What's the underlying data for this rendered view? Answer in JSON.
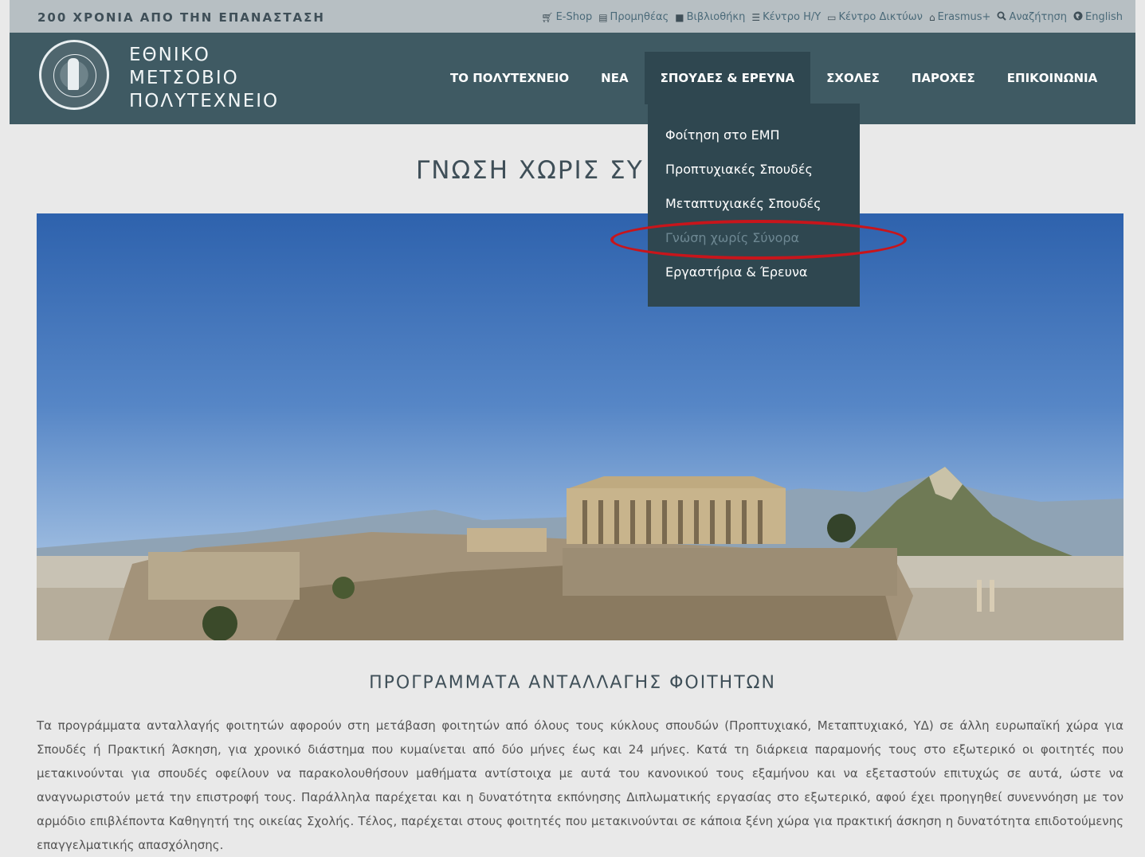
{
  "topbar": {
    "slogan": "200 ΧΡΟΝΙΑ ΑΠΟ ΤΗΝ ΕΠΑΝΑΣΤΑΣΗ",
    "links": [
      {
        "icon": "cart-icon",
        "label": "E-Shop"
      },
      {
        "icon": "newspaper-icon",
        "label": "Προμηθέας"
      },
      {
        "icon": "book-icon",
        "label": "Βιβλιοθήκη"
      },
      {
        "icon": "server-icon",
        "label": "Κέντρο Η/Υ"
      },
      {
        "icon": "network-icon",
        "label": "Κέντρο Δικτύων"
      },
      {
        "icon": "institution-icon",
        "label": "Erasmus+"
      },
      {
        "icon": "search-icon",
        "label": "Αναζήτηση"
      },
      {
        "icon": "globe-icon",
        "label": "English"
      }
    ]
  },
  "logo": {
    "lines": [
      "ΕΘΝΙΚΟ",
      "ΜΕΤΣΟΒΙΟ",
      "ΠΟΛΥΤΕΧΝΕΙΟ"
    ]
  },
  "nav": {
    "items": [
      {
        "label": "ΤΟ ΠΟΛΥΤΕΧΝΕΙΟ"
      },
      {
        "label": "ΝΕΑ"
      },
      {
        "label": "ΣΠΟΥΔΕΣ & ΕΡΕΥΝΑ",
        "active": true
      },
      {
        "label": "ΣΧΟΛΕΣ"
      },
      {
        "label": "ΠΑΡΟΧΕΣ"
      },
      {
        "label": "ΕΠΙΚΟΙΝΩΝΙΑ"
      }
    ]
  },
  "dropdown": {
    "items": [
      {
        "label": "Φοίτηση στο ΕΜΠ"
      },
      {
        "label": "Προπτυχιακές Σπουδές"
      },
      {
        "label": "Μεταπτυχιακές Σπουδές"
      },
      {
        "label": "Γνώση χωρίς Σύνορα",
        "current": true
      },
      {
        "label": "Εργαστήρια & Έρευνα"
      }
    ]
  },
  "page": {
    "title": "ΓΝΩΣΗ ΧΩΡΙΣ ΣΥ",
    "section_heading": "ΠΡΟΓΡΑΜΜΑΤΑ ΑΝΤΑΛΛΑΓΗΣ ΦΟΙΤΗΤΩΝ",
    "body": "Τα προγράμματα ανταλλαγής φοιτητών αφορούν στη μετάβαση φοιτητών από όλους τους κύκλους σπουδών (Προπτυχιακό, Μεταπτυχιακό, ΥΔ) σε άλλη ευρωπαϊκή χώρα για Σπουδές ή Πρακτική Άσκηση, για χρονικό διάστημα που κυμαίνεται από δύο μήνες έως και 24 μήνες. Κατά τη διάρκεια παραμονής τους στο εξωτερικό οι φοιτητές που μετακινούνται για σπουδές οφείλουν να παρακολουθήσουν μαθήματα αντίστοιχα με αυτά του κανονικού τους εξαμήνου και να εξεταστούν επιτυχώς σε αυτά, ώστε να αναγνωριστούν μετά την επιστροφή τους. Παράλληλα παρέχεται και η δυνατότητα εκπόνησης Διπλωματικής εργασίας στο εξωτερικό, αφού έχει προηγηθεί συνεννόηση με τον αρμόδιο επιβλέποντα Καθηγητή της οικείας Σχολής. Τέλος, παρέχεται στους φοιτητές που μετακινούνται σε κάποια ξένη χώρα για πρακτική άσκηση η δυνατότητα επιδοτούμενης επαγγελματικής απασχόλησης."
  },
  "colors": {
    "header_bg": "#3f5a63",
    "topbar_bg": "#b7bfc3",
    "dropdown_bg": "#2f4750",
    "highlight": "#c8151b"
  }
}
